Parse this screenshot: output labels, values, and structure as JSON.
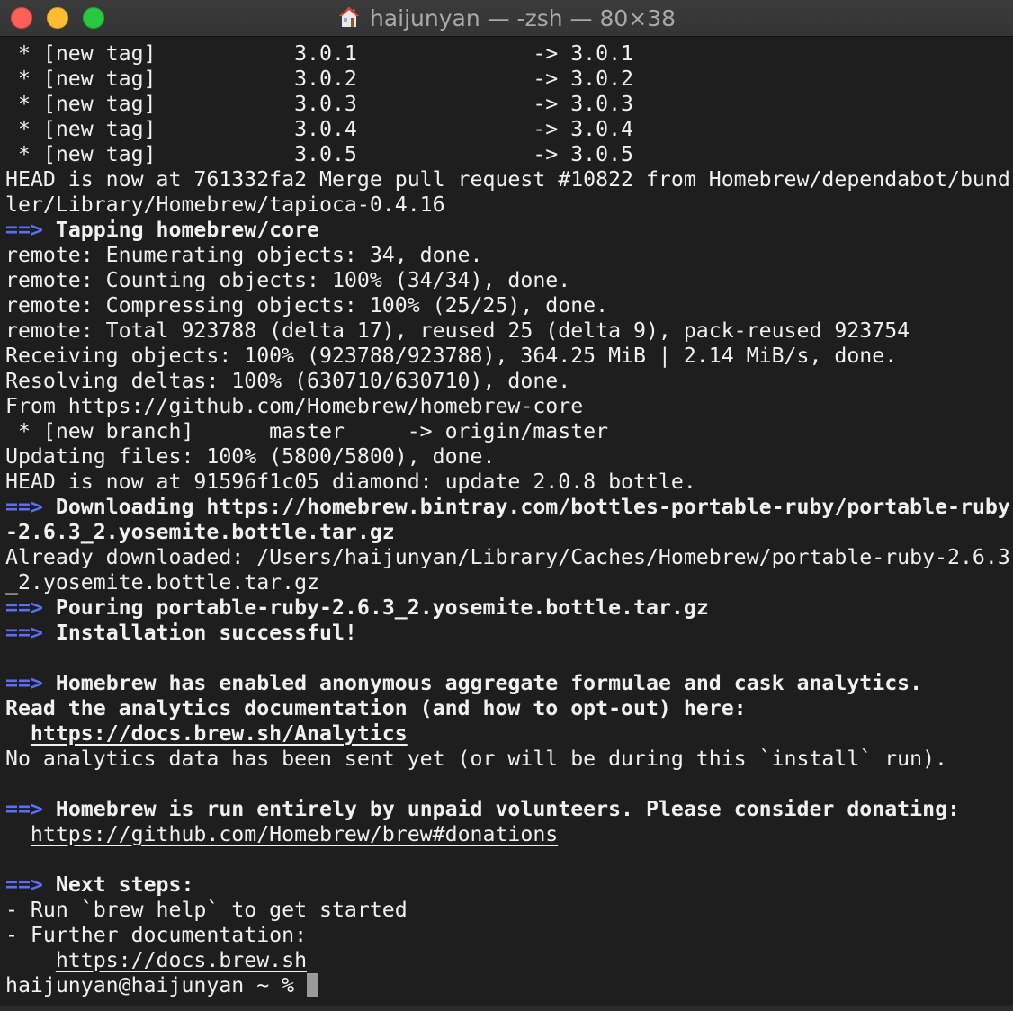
{
  "window": {
    "title": "haijunyan — -zsh — 80×38",
    "colors": {
      "background": "#1e1e1e",
      "text": "#f0f0f0",
      "arrow": "#5b6ef7"
    }
  },
  "terminal": {
    "tags": [
      {
        "left": " * [new tag]           3.0.1              -> 3.0.1"
      },
      {
        "left": " * [new tag]           3.0.2              -> 3.0.2"
      },
      {
        "left": " * [new tag]           3.0.3              -> 3.0.3"
      },
      {
        "left": " * [new tag]           3.0.4              -> 3.0.4"
      },
      {
        "left": " * [new tag]           3.0.5              -> 3.0.5"
      }
    ],
    "head1_a": "HEAD is now at 761332fa2 Merge pull request #10822 from Homebrew/dependabot/bund",
    "head1_b": "ler/Library/Homebrew/tapioca-0.4.16",
    "arrow": "==>",
    "tapping": "Tapping homebrew/core",
    "remote1": "remote: Enumerating objects: 34, done.",
    "remote2": "remote: Counting objects: 100% (34/34), done.",
    "remote3": "remote: Compressing objects: 100% (25/25), done.",
    "remote4": "remote: Total 923788 (delta 17), reused 25 (delta 9), pack-reused 923754",
    "receiving": "Receiving objects: 100% (923788/923788), 364.25 MiB | 2.14 MiB/s, done.",
    "resolving": "Resolving deltas: 100% (630710/630710), done.",
    "from": "From https://github.com/Homebrew/homebrew-core",
    "branch": " * [new branch]      master     -> origin/master",
    "updating": "Updating files: 100% (5800/5800), done.",
    "head2": "HEAD is now at 91596f1c05 diamond: update 2.0.8 bottle.",
    "downloading_a": "Downloading https://homebrew.bintray.com/bottles-portable-ruby/portable-ruby",
    "downloading_b": "-2.6.3_2.yosemite.bottle.tar.gz",
    "already_a": "Already downloaded: /Users/haijunyan/Library/Caches/Homebrew/portable-ruby-2.6.3",
    "already_b": "_2.yosemite.bottle.tar.gz",
    "pouring": "Pouring portable-ruby-2.6.3_2.yosemite.bottle.tar.gz",
    "installation": "Installation successful!",
    "analytics_heading": "Homebrew has enabled anonymous aggregate formulae and cask analytics.",
    "analytics_read": "Read the analytics documentation (and how to opt-out) here:",
    "analytics_indent": "  ",
    "analytics_url": "https://docs.brew.sh/Analytics",
    "analytics_note": "No analytics data has been sent yet (or will be during this `install` run).",
    "volunteers": "Homebrew is run entirely by unpaid volunteers. Please consider donating:",
    "donations_indent": "  ",
    "donations_url": "https://github.com/Homebrew/brew#donations",
    "next_steps": "Next steps:",
    "step1": "- Run `brew help` to get started",
    "step2": "- Further documentation:",
    "docs_indent": "    ",
    "docs_url": "https://docs.brew.sh",
    "prompt": "haijunyan@haijunyan ~ % "
  }
}
